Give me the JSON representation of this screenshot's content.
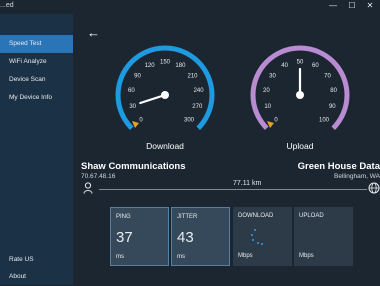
{
  "window": {
    "title": "...ed",
    "buttons": [
      "—",
      "☐",
      "✕"
    ]
  },
  "sidebar": {
    "items": [
      {
        "label": "Speed Test",
        "active": true
      },
      {
        "label": "WiFi Analyze",
        "active": false
      },
      {
        "label": "Device Scan",
        "active": false
      },
      {
        "label": "My Device Info",
        "active": false
      }
    ],
    "bottom_items": [
      {
        "label": "Rate US"
      },
      {
        "label": "About"
      }
    ]
  },
  "gauges": {
    "download": {
      "label": "Download",
      "ticks": [
        "0",
        "30",
        "60",
        "90",
        "120",
        "150",
        "180",
        "210",
        "240",
        "270",
        "300"
      ],
      "color": "#1e9be0",
      "reading": 30
    },
    "upload": {
      "label": "Upload",
      "ticks": [
        "0",
        "10",
        "20",
        "30",
        "40",
        "50",
        "60",
        "70",
        "80",
        "90",
        "100"
      ],
      "color": "#b98cd2",
      "reading": 50
    }
  },
  "isp": {
    "name": "Shaw Communications",
    "ip": "70.67.48.16"
  },
  "server": {
    "name": "Green House Data",
    "location": "Bellingham, WA"
  },
  "distance": "77.11 km",
  "tiles": [
    {
      "title": "PING",
      "value": "37",
      "unit": "ms"
    },
    {
      "title": "JITTER",
      "value": "43",
      "unit": "ms"
    },
    {
      "title": "DOWNLOAD",
      "value": "",
      "unit": "Mbps"
    },
    {
      "title": "UPLOAD",
      "value": "",
      "unit": "Mbps"
    }
  ],
  "colors": {
    "accent": "#2a74b8",
    "pointer": "#e8a21e"
  }
}
